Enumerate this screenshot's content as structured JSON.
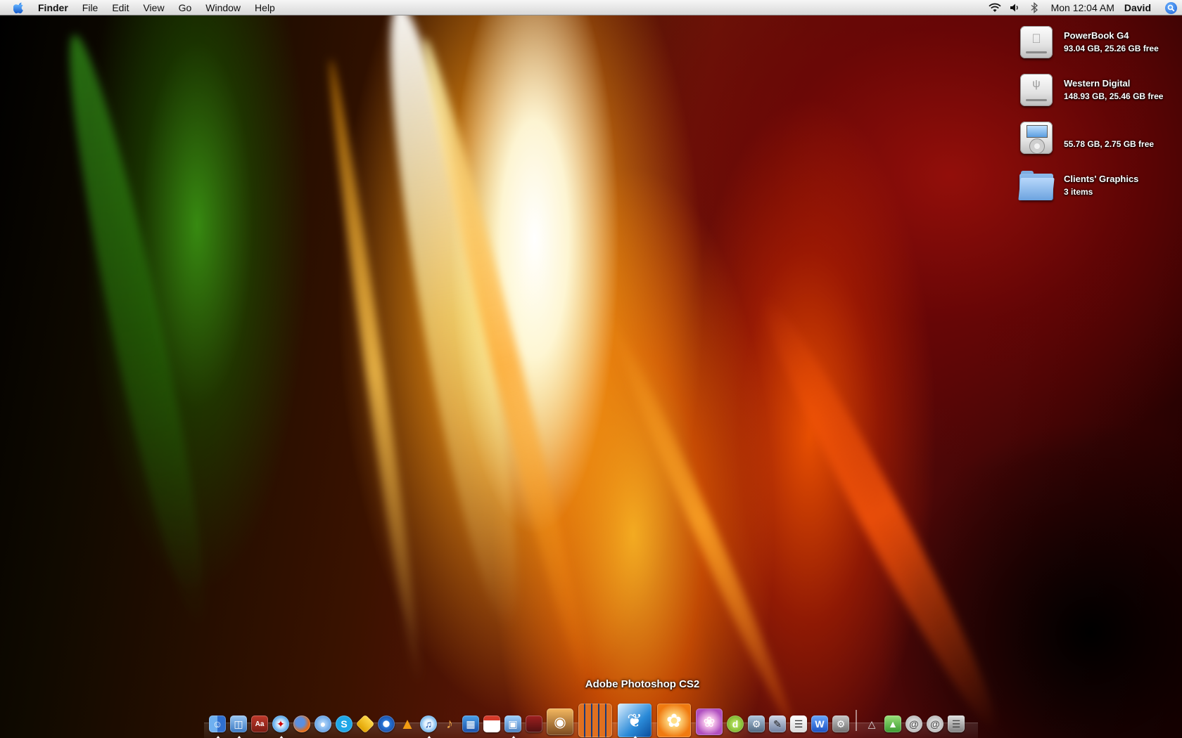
{
  "menubar": {
    "apple_icon": "apple-logo-icon",
    "app_name": "Finder",
    "menus": [
      "File",
      "Edit",
      "View",
      "Go",
      "Window",
      "Help"
    ],
    "status_icons": [
      "wifi-icon",
      "volume-icon",
      "bluetooth-icon"
    ],
    "clock": "Mon 12:04 AM",
    "user": "David",
    "spotlight_icon": "spotlight-icon"
  },
  "desktop_icons": [
    {
      "title": "PowerBook G4",
      "subtitle": "93.04 GB, 25.26 GB free",
      "icon": "internal-drive-icon"
    },
    {
      "title": "Western Digital",
      "subtitle": "148.93 GB, 25.46 GB free",
      "icon": "usb-drive-icon"
    },
    {
      "title": "",
      "subtitle": "55.78 GB, 2.75 GB free",
      "icon": "ipod-icon"
    },
    {
      "title": "Clients' Graphics",
      "subtitle": "3 items",
      "icon": "folder-icon"
    }
  ],
  "dock": {
    "tooltip": "Adobe Photoshop CS2",
    "colors": {
      "accent": "#1a5fd6",
      "shelf": "#ffffff"
    }
  }
}
